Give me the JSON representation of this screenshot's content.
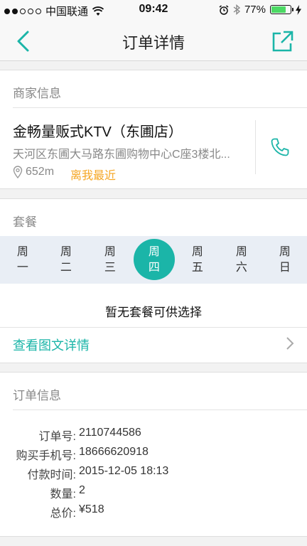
{
  "status_bar": {
    "carrier": "中国联通",
    "time": "09:42",
    "battery": "77%",
    "battery_level": 0.77
  },
  "nav": {
    "title": "订单详情"
  },
  "merchant": {
    "section_title": "商家信息",
    "name": "金畅量贩式KTV（东圃店）",
    "address": "天河区东圃大马路东圃购物中心C座3楼北...",
    "distance": "652m",
    "nearest_tag": "离我最近"
  },
  "package": {
    "section_title": "套餐",
    "days": [
      {
        "line1": "周",
        "line2": "一"
      },
      {
        "line1": "周",
        "line2": "二"
      },
      {
        "line1": "周",
        "line2": "三"
      },
      {
        "line1": "周",
        "line2": "四"
      },
      {
        "line1": "周",
        "line2": "五"
      },
      {
        "line1": "周",
        "line2": "六"
      },
      {
        "line1": "周",
        "line2": "日"
      }
    ],
    "selected_day": "周四",
    "empty_text": "暂无套餐可供选择",
    "detail_link": "查看图文详情"
  },
  "order": {
    "section_title": "订单信息",
    "rows": [
      {
        "label": "订单号:",
        "value": "2110744586"
      },
      {
        "label": "购买手机号:",
        "value": "18666620918"
      },
      {
        "label": "付款时间:",
        "value": "2015-12-05 18:13"
      },
      {
        "label": "数量:",
        "value": "2"
      },
      {
        "label": "总价:",
        "value": "¥518"
      }
    ]
  },
  "colors": {
    "accent": "#1bb5a8",
    "highlight": "#f5a623"
  }
}
